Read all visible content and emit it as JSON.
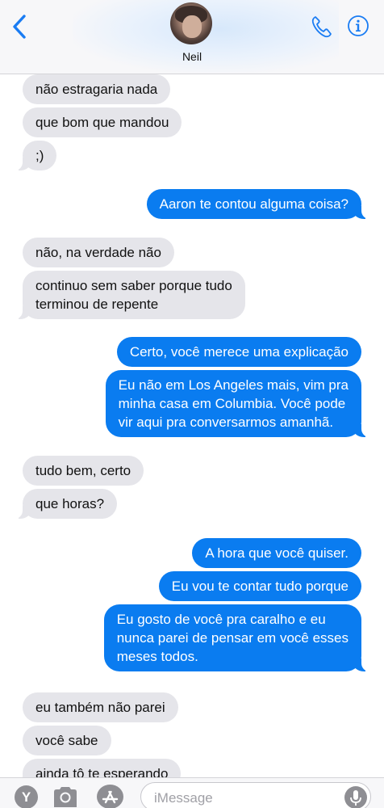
{
  "header": {
    "contact_name": "Neil"
  },
  "messages": [
    {
      "direction": "in",
      "text": "não estragaria nada"
    },
    {
      "direction": "in",
      "text": "que bom que mandou"
    },
    {
      "direction": "in",
      "text": ";)"
    },
    {
      "direction": "out",
      "text": "Aaron te contou alguma coisa?"
    },
    {
      "direction": "in",
      "text": "não, na verdade não"
    },
    {
      "direction": "in",
      "text": "continuo sem saber porque tudo\nterminou de repente"
    },
    {
      "direction": "out",
      "text": "Certo, você merece uma explicação"
    },
    {
      "direction": "out",
      "text": "Eu não em Los Angeles mais, vim pra\nminha casa em Columbia. Você pode\nvir aqui pra conversarmos amanhã."
    },
    {
      "direction": "in",
      "text": "tudo bem, certo"
    },
    {
      "direction": "in",
      "text": "que horas?"
    },
    {
      "direction": "out",
      "text": "A hora que você quiser."
    },
    {
      "direction": "out",
      "text": "Eu vou te contar tudo porque"
    },
    {
      "direction": "out",
      "text": "Eu gosto de você pra caralho e eu\nnunca parei de pensar em você esses\nmeses todos."
    },
    {
      "direction": "in",
      "text": "eu também não parei"
    },
    {
      "direction": "in",
      "text": "você sabe"
    },
    {
      "direction": "in",
      "text": "ainda tô te esperando"
    }
  ],
  "compose": {
    "app_letter": "Y",
    "placeholder": "iMessage"
  },
  "colors": {
    "outgoing_bubble": "#0a7cf0",
    "incoming_bubble": "#e5e5ea",
    "accent": "#007aff"
  },
  "icons": [
    "back-chevron-icon",
    "phone-icon",
    "info-icon",
    "camera-icon",
    "app-store-icon",
    "microphone-icon"
  ]
}
